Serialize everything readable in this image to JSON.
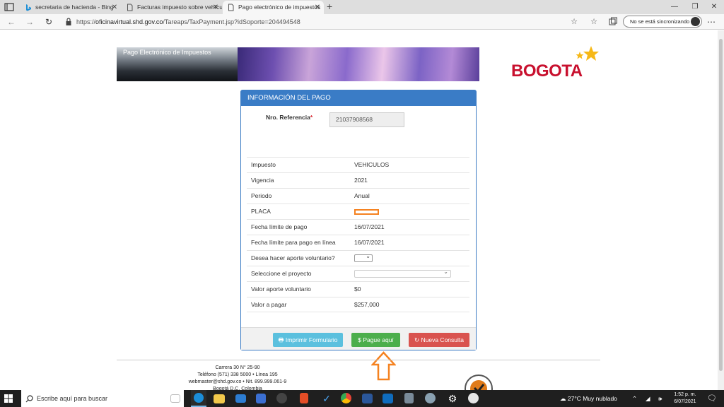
{
  "browser": {
    "tabs": [
      {
        "title": "secretaria de hacienda - Bing",
        "icon": "bing-icon"
      },
      {
        "title": "Facturas impuesto sobre vehícul",
        "icon": "document-icon"
      },
      {
        "title": "Pago electrónico de impuestos",
        "icon": "document-icon"
      }
    ],
    "url_prefix": "https://",
    "url_host": "oficinavirtual.shd.gov.co",
    "url_path": "/Tareaps/TaxPayment.jsp?idSoporte=204494548",
    "sync_label": "No se está sincronizando"
  },
  "page": {
    "banner_title": "Pago Electrónico de Impuestos",
    "logo_text": "BOGOTA",
    "panel_title": "INFORMACIÓN DEL PAGO",
    "ref_label": "Nro. Referencia",
    "ref_required": "*",
    "ref_value": "21037908568",
    "rows": [
      {
        "label": "Impuesto",
        "value": "VEHICULOS"
      },
      {
        "label": "Vigencia",
        "value": "2021"
      },
      {
        "label": "Periodo",
        "value": "Anual"
      },
      {
        "label": "PLACA",
        "value": ""
      },
      {
        "label": "Fecha límite de pago",
        "value": "16/07/2021"
      },
      {
        "label": "Fecha límite para pago en línea",
        "value": "16/07/2021"
      },
      {
        "label": "Desea hacer aporte voluntario?",
        "value": ""
      },
      {
        "label": "Seleccione el proyecto",
        "value": ""
      },
      {
        "label": "Valor aporte voluntario",
        "value": "$0"
      },
      {
        "label": "Valor a pagar",
        "value": "$257,000"
      }
    ],
    "buttons": {
      "print": "Imprimir Formulario",
      "pay": "Pague aquí",
      "new": "Nueva Consulta"
    },
    "footer_lines": [
      "Carrera 30 N° 25-90",
      "Teléfono (571) 338 5000 • Línea 195",
      "webmaster@shd.gov.co • Nit. 899.999.061-9",
      "Bogotá D.C. Colombia"
    ]
  },
  "taskbar": {
    "search_placeholder": "Escribe aquí para buscar",
    "weather": "27°C  Muy nublado",
    "time": "1:52 p. m.",
    "date": "6/07/2021"
  },
  "colors": {
    "panel_header": "#3a7cc6",
    "btn_print": "#5bc0de",
    "btn_pay": "#4cae4c",
    "btn_new": "#d9534f",
    "logo_red": "#c8102e",
    "annotation_orange": "#f58220"
  }
}
